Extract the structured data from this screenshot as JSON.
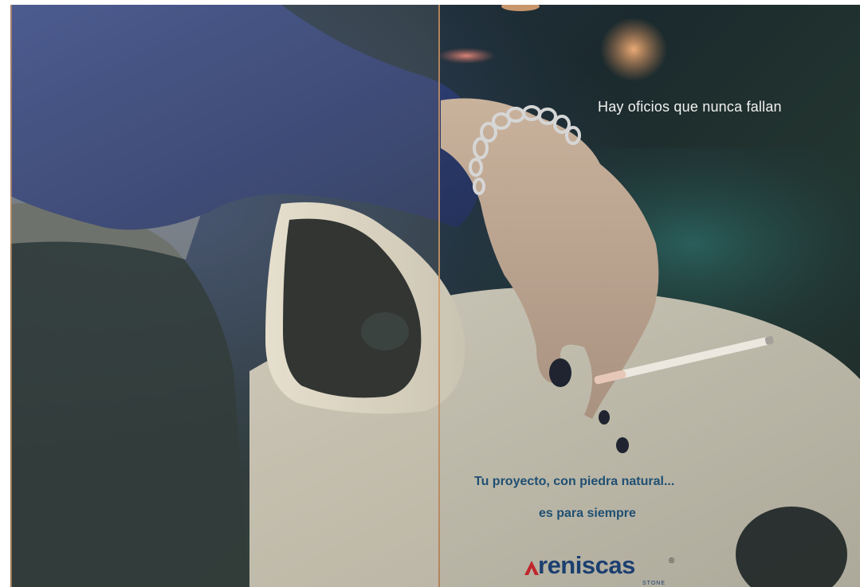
{
  "ad": {
    "headline": "Hay oficios que nunca fallan",
    "tagline_line1": "Tu proyecto, con piedra natural...",
    "tagline_line2": "es para siempre"
  },
  "brand": {
    "name": "reniscas",
    "mark": "ʌ",
    "registered": "®",
    "sub": "STONE",
    "colors": {
      "navy": "#1c3f70",
      "accent": "#c0262c",
      "headline_text": "#f2f2f0",
      "tagline_text": "#1f4f72"
    }
  },
  "photo": {
    "subject": "photo-hand-cigarette-car-mirror"
  }
}
